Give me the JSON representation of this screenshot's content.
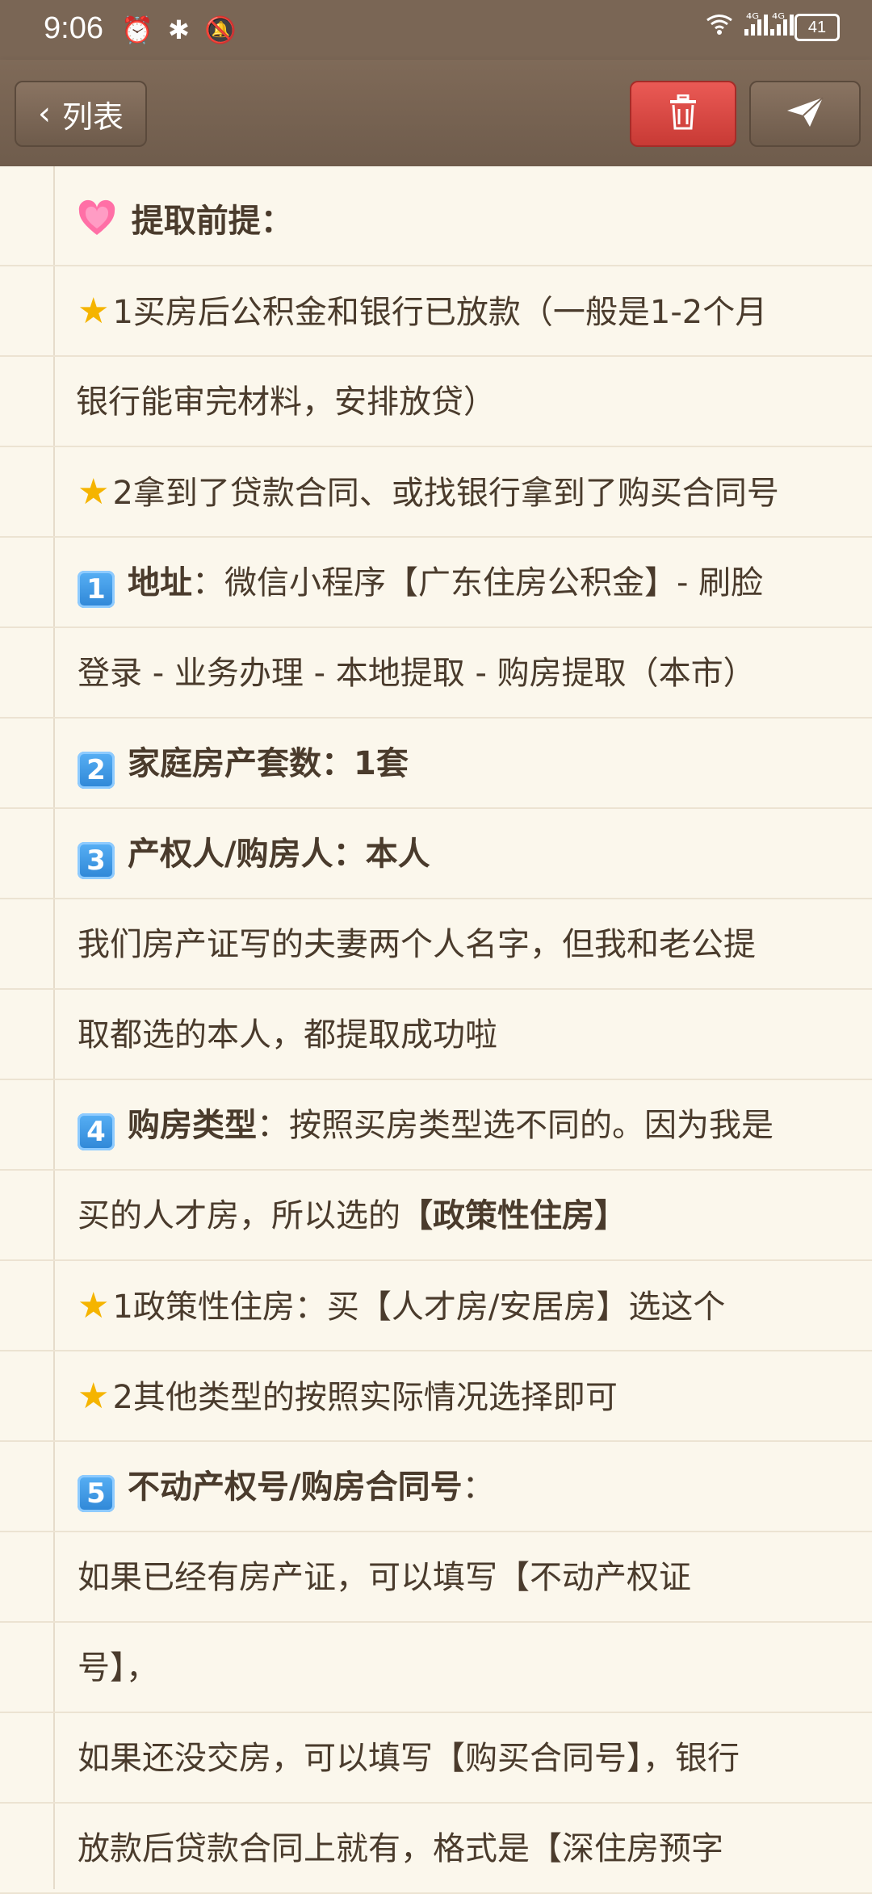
{
  "status_bar": {
    "time": "9:06",
    "left_icons": "⏰ ✱ 🔕",
    "network1": "⁴ᴳ",
    "network2": "⁴ᴳ",
    "battery": "41"
  },
  "toolbar": {
    "back_label": "列表"
  },
  "note": {
    "lines": [
      {
        "pre": "",
        "bold": "提取前提：",
        "rest": ""
      },
      {
        "pre": "1买房后公积金和银行已放款（一般是1-2个月",
        "bold": "",
        "rest": ""
      },
      {
        "pre": "银行能审完材料，安排放贷）",
        "bold": "",
        "rest": ""
      },
      {
        "pre": "2拿到了贷款合同、或找银行拿到了购买合同号",
        "bold": "",
        "rest": ""
      },
      {
        "pre": "",
        "bold": "地址",
        "rest": "：微信小程序【广东住房公积金】- 刷脸"
      },
      {
        "pre": "登录 - 业务办理 - 本地提取 - 购房提取（本市）",
        "bold": "",
        "rest": ""
      },
      {
        "pre": "",
        "bold": "家庭房产套数：1套",
        "rest": ""
      },
      {
        "pre": "",
        "bold": "产权人/购房人：本人",
        "rest": ""
      },
      {
        "pre": "我们房产证写的夫妻两个人名字，但我和老公提",
        "bold": "",
        "rest": ""
      },
      {
        "pre": "取都选的本人，都提取成功啦",
        "bold": "",
        "rest": ""
      },
      {
        "pre": "",
        "bold": "购房类型",
        "rest": "：按照买房类型选不同的。因为我是"
      },
      {
        "pre": "买的人才房，所以选的",
        "bold": "【政策性住房】",
        "rest": ""
      },
      {
        "pre": "1政策性住房：买【人才房/安居房】选这个",
        "bold": "",
        "rest": ""
      },
      {
        "pre": "2其他类型的按照实际情况选择即可",
        "bold": "",
        "rest": ""
      },
      {
        "pre": "",
        "bold": "不动产权号/购房合同号",
        "rest": "："
      },
      {
        "pre": "如果已经有房产证，可以填写【不动产权证",
        "bold": "",
        "rest": ""
      },
      {
        "pre": "号】，",
        "bold": "",
        "rest": ""
      },
      {
        "pre": "如果还没交房，可以填写【购买合同号】，银行",
        "bold": "",
        "rest": ""
      },
      {
        "pre": "放款后贷款合同上就有，格式是【深住房预字",
        "bold": "",
        "rest": ""
      }
    ],
    "keycaps": [
      "1",
      "2",
      "3",
      "4",
      "5"
    ]
  }
}
